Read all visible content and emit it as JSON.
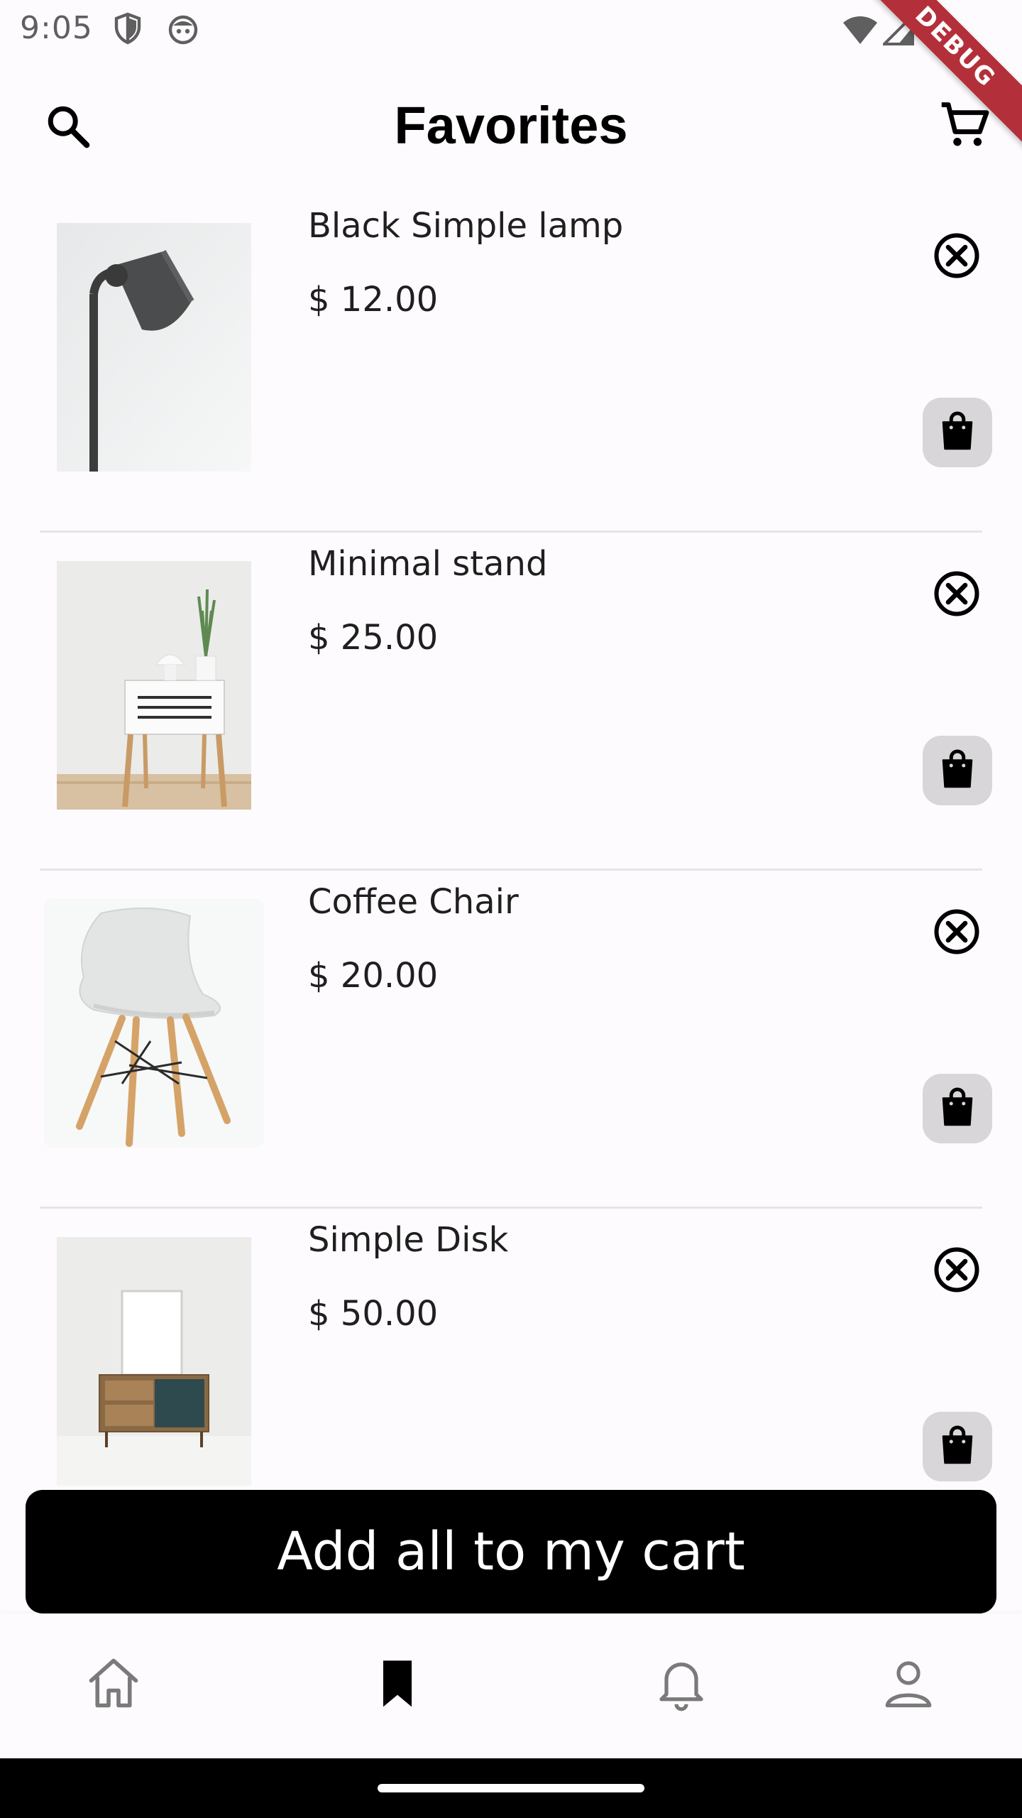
{
  "status_bar": {
    "time": "9:05",
    "debug_label": "DEBUG"
  },
  "app_bar": {
    "title": "Favorites",
    "search_icon": "search-icon",
    "cart_icon": "cart-icon"
  },
  "items": [
    {
      "name": "Black Simple lamp",
      "price": "$ 12.00",
      "image": "floor-lamp"
    },
    {
      "name": "Minimal stand",
      "price": "$ 25.00",
      "image": "side-table"
    },
    {
      "name": "Coffee Chair",
      "price": "$ 20.00",
      "image": "chair"
    },
    {
      "name": "Simple Disk",
      "price": "$ 50.00",
      "image": "cabinet"
    }
  ],
  "cta": {
    "label": "Add all to my cart"
  },
  "bottom_nav": {
    "items": [
      {
        "icon": "home-icon",
        "active": false
      },
      {
        "icon": "bookmark-icon",
        "active": true
      },
      {
        "icon": "bell-icon",
        "active": false
      },
      {
        "icon": "profile-icon",
        "active": false
      }
    ]
  },
  "colors": {
    "background": "#fefbfe",
    "primary": "#000000",
    "bag_button_bg": "#d8d6d8",
    "debug_ribbon": "#b3303a",
    "inactive_icon": "#7a7a7a"
  }
}
